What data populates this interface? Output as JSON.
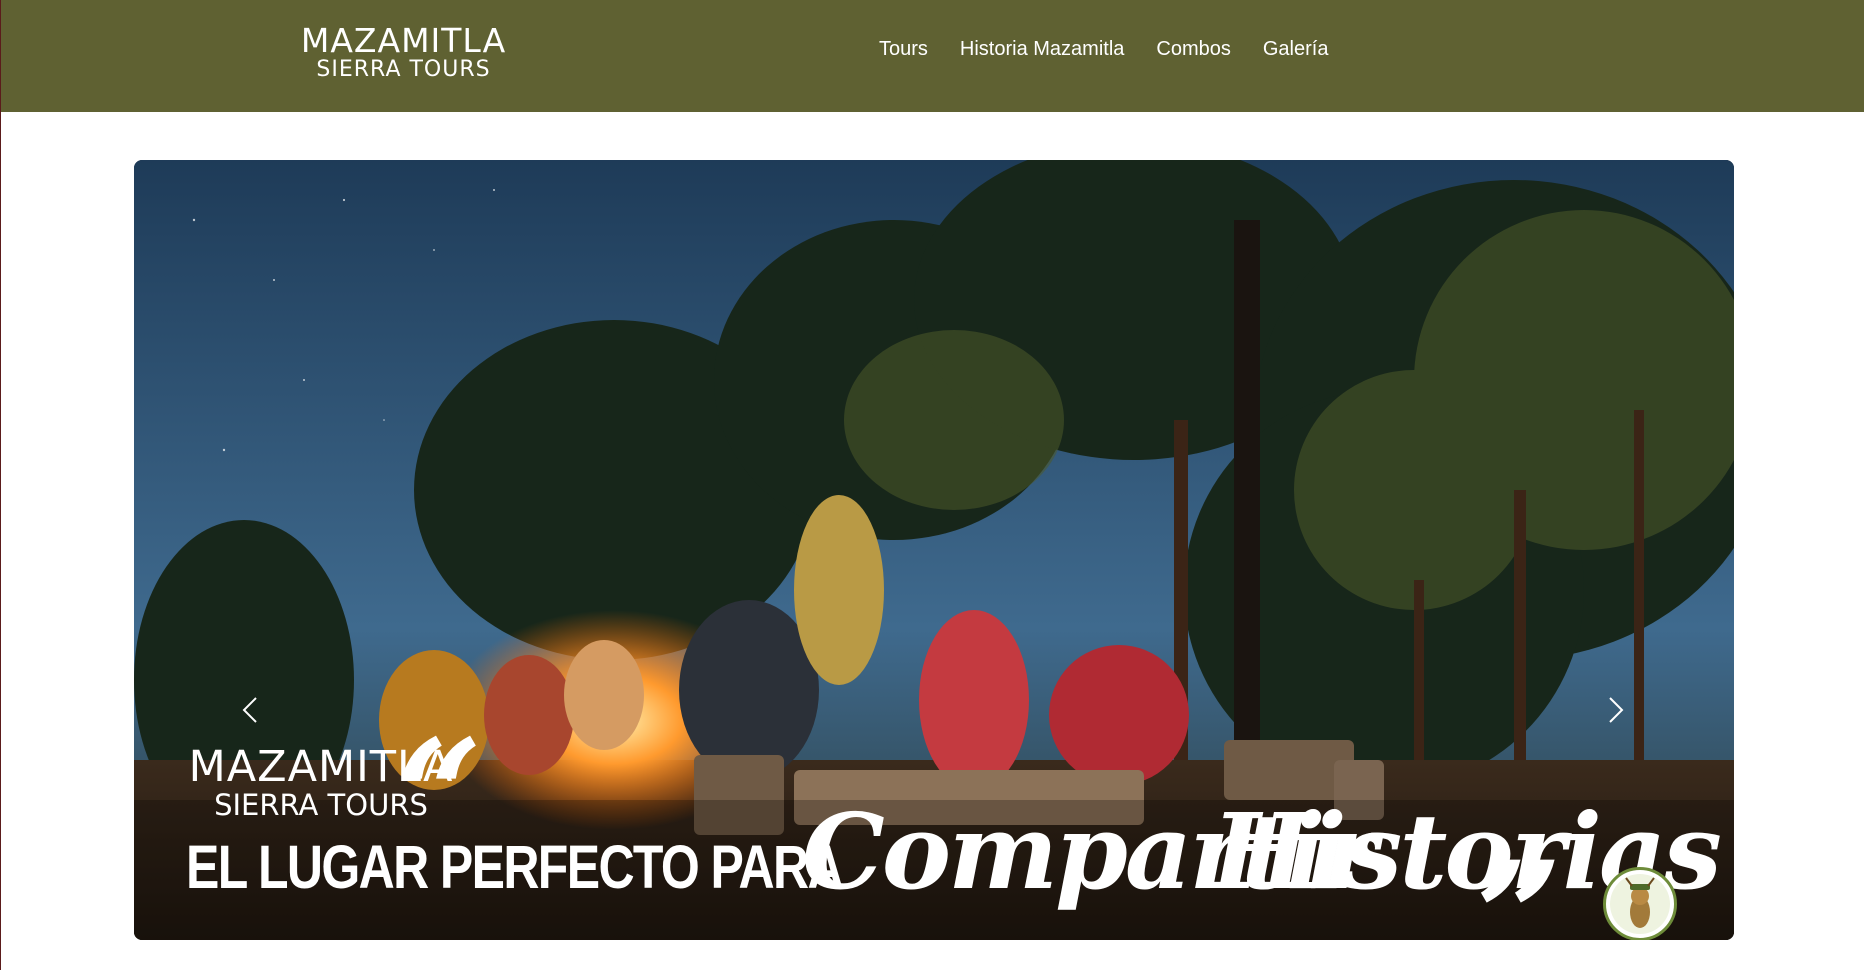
{
  "header": {
    "logo_line1": "MAZAMITLA",
    "logo_line2": "SIERRA TOURS",
    "nav": [
      {
        "label": "Tours"
      },
      {
        "label": "Historia Mazamitla"
      },
      {
        "label": "Combos"
      },
      {
        "label": "Galería"
      }
    ],
    "background_color": "#5f6132"
  },
  "hero": {
    "logo_line1": "MAZAMITLA",
    "logo_line2": "SIERRA TOURS",
    "tagline": "EL LUGAR PERFECTO PARA",
    "script_word1": "Compartir",
    "script_word2": "Historias",
    "open_quote": "“",
    "close_quote": "”",
    "prev_icon": "chevron-left-icon",
    "next_icon": "chevron-right-icon",
    "mascot_icon": "deer-mascot-icon"
  }
}
